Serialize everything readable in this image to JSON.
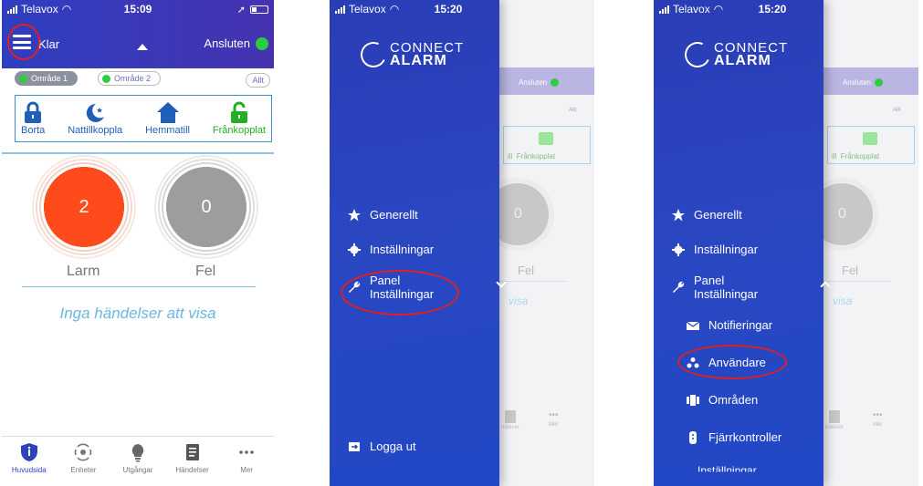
{
  "colors": {
    "brand_blue": "#2b3fb8",
    "connected_green": "#2ecc40",
    "alarm_red": "#ff4a1c",
    "annotation_red": "#e02020"
  },
  "phone1": {
    "status_bar": {
      "carrier": "Telavox",
      "time": "15:09"
    },
    "header": {
      "status": "Klar",
      "connection": "Ansluten",
      "menu_icon": "hamburger-icon"
    },
    "areas": [
      {
        "label": "Område 1",
        "active": true
      },
      {
        "label": "Område 2",
        "active": false
      }
    ],
    "all_label": "Allt",
    "modes": [
      {
        "label": "Borta",
        "icon": "lock-icon"
      },
      {
        "label": "Nattillkoppla",
        "icon": "moon-star-icon"
      },
      {
        "label": "Hemmatill",
        "icon": "home-icon"
      },
      {
        "label": "Frånkopplat",
        "icon": "unlock-icon"
      }
    ],
    "alarm_count": "2",
    "alarm_label": "Larm",
    "fault_count": "0",
    "fault_label": "Fel",
    "no_events": "Inga händelser att visa",
    "tabs": [
      {
        "label": "Huvudsida",
        "icon": "shield-icon",
        "active": true
      },
      {
        "label": "Enheter",
        "icon": "sensor-icon",
        "active": false
      },
      {
        "label": "Utgångar",
        "icon": "bulb-icon",
        "active": false
      },
      {
        "label": "Händelser",
        "icon": "document-icon",
        "active": false
      },
      {
        "label": "Mer",
        "icon": "more-icon",
        "active": false
      }
    ]
  },
  "phone2": {
    "status_bar": {
      "carrier": "Telavox",
      "time": "15:20"
    },
    "logo": {
      "line1": "CONNECT",
      "line2": "ALARM"
    },
    "menu": {
      "general": "Generellt",
      "settings": "Inställningar",
      "panel_line1": "Panel",
      "panel_line2": "Inställningar",
      "logout": "Logga ut"
    },
    "background": {
      "connection": "Ansluten",
      "all": "Allt",
      "mode": "Frånkopplat",
      "mode_partial": "ill",
      "fault": "Fel",
      "visa": "visa",
      "tab1": "ndelser",
      "tab2": "Mer"
    }
  },
  "phone3": {
    "status_bar": {
      "carrier": "Telavox",
      "time": "15:20"
    },
    "logo": {
      "line1": "CONNECT",
      "line2": "ALARM"
    },
    "menu": {
      "general": "Generellt",
      "settings": "Inställningar",
      "panel_line1": "Panel",
      "panel_line2": "Inställningar",
      "notifications": "Notifieringar",
      "users": "Användare",
      "areas": "Områden",
      "remotes": "Fjärrkontroller",
      "cut_item": "Inställningar"
    },
    "background": {
      "connection": "Ansluten",
      "all": "Allt",
      "mode": "Frånkopplat",
      "mode_partial": "ill",
      "fault": "Fel",
      "visa": "visa",
      "tab1": "ndelser",
      "tab2": "Mer"
    }
  }
}
